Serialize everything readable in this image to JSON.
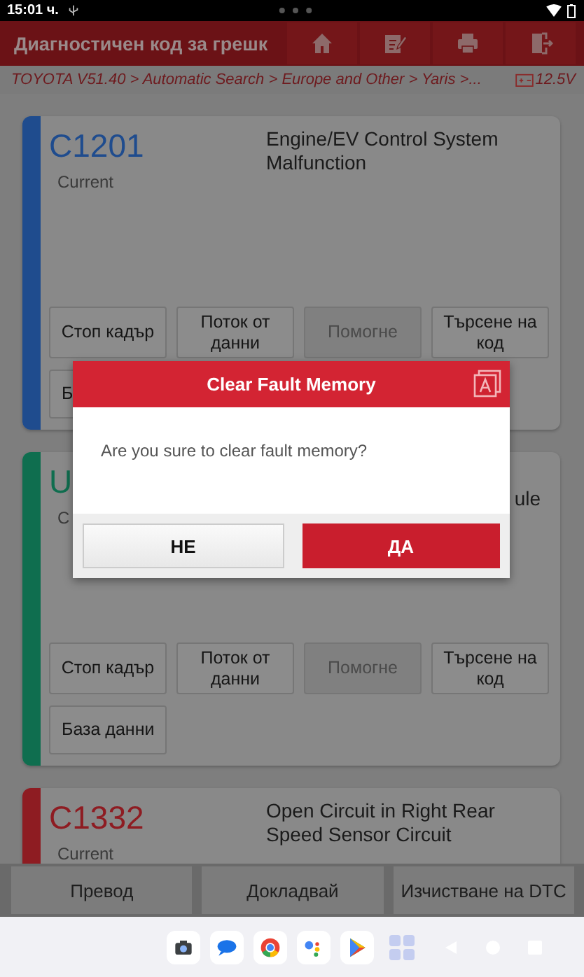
{
  "status_bar": {
    "time": "15:01 ч."
  },
  "header": {
    "title": "Диагностичен код за грешк"
  },
  "breadcrumb": {
    "path": "TOYOTA V51.40 > Automatic Search > Europe and Other > Yaris >...",
    "voltage": "12.5V"
  },
  "cards": [
    {
      "kind": "full",
      "code": "C1201",
      "status": "Current",
      "description": "Engine/EV Control System Malfunction",
      "color": "#1f4c8e",
      "buttons": [
        {
          "label": "Стоп кадър",
          "disabled": false
        },
        {
          "label": "Поток от данни",
          "disabled": false
        },
        {
          "label": "Помогне",
          "disabled": true
        },
        {
          "label": "Търсене на код",
          "disabled": false
        },
        {
          "label": "Б",
          "disabled": false
        }
      ]
    },
    {
      "kind": "covered",
      "code": "U",
      "status": "C",
      "description": "ule",
      "color": "#0f6e4f",
      "buttons": [
        {
          "label": "Стоп кадър",
          "disabled": false
        },
        {
          "label": "Поток от данни",
          "disabled": false
        },
        {
          "label": "Помогне",
          "disabled": true
        },
        {
          "label": "Търсене на код",
          "disabled": false
        },
        {
          "label": "База данни",
          "disabled": false
        }
      ]
    },
    {
      "kind": "full",
      "code": "C1332",
      "status": "Current",
      "description": "Open Circuit in Right Rear Speed Sensor Circuit",
      "color": "#8e1c22"
    }
  ],
  "bottom_buttons": [
    "Превод",
    "Докладвай",
    "Изчистване на DTC"
  ],
  "dialog": {
    "title": "Clear Fault Memory",
    "message": "Are you sure to clear fault memory?",
    "buttons": [
      {
        "label": "НЕ",
        "kind": "secondary"
      },
      {
        "label": "ДА",
        "kind": "primary"
      }
    ]
  }
}
